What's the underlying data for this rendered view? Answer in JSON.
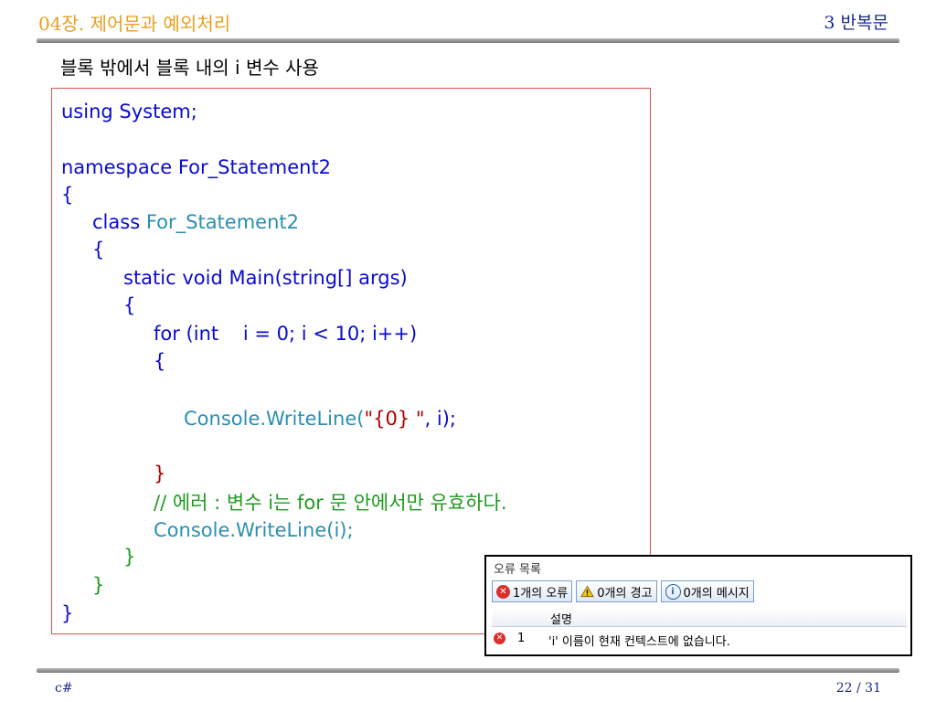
{
  "header": {
    "chapter": "04장. 제어문과 예외처리",
    "section": "3 반복문"
  },
  "subtitle": "블록 밖에서 블록 내의 i 변수 사용",
  "code": {
    "l1": "using System;",
    "l2": "namespace For_Statement2",
    "l3": "{",
    "l4a": "class ",
    "l4b": "For_Statement2",
    "l5": "{",
    "l6": "static void Main(string[] args)",
    "l7": "{",
    "l8": "for (int    i = 0; i < 10; i++)",
    "l9": "{",
    "l10a": "Console.WriteLine(",
    "l10b": "\"{0} \"",
    "l10c": ", i);",
    "l11": "}",
    "l12": "// 에러 : 변수 i는 for 문 안에서만 유효하다.",
    "l13": "Console.WriteLine(i);",
    "l14": "}",
    "l15": "}",
    "l16": "}"
  },
  "error_list": {
    "title": "오류 목록",
    "errors_btn": "1개의 오류",
    "warnings_btn": "0개의 경고",
    "messages_btn": "0개의 메시지",
    "column_desc": "설명",
    "row_num": "1",
    "row_desc": "'i' 이름이 현재 컨텍스트에 없습니다."
  },
  "footer": {
    "left": "c#",
    "page": "22 / 31"
  },
  "colors": {
    "accent": "#e8a020",
    "navy": "#1a2a8a",
    "keyword": "#0b0bd0",
    "type": "#2b8fb0",
    "comment": "#1f9a1f",
    "box_border": "#d9534f"
  },
  "icons": {
    "error": "error-circle-icon",
    "warning": "warning-triangle-icon",
    "info": "info-circle-icon"
  }
}
